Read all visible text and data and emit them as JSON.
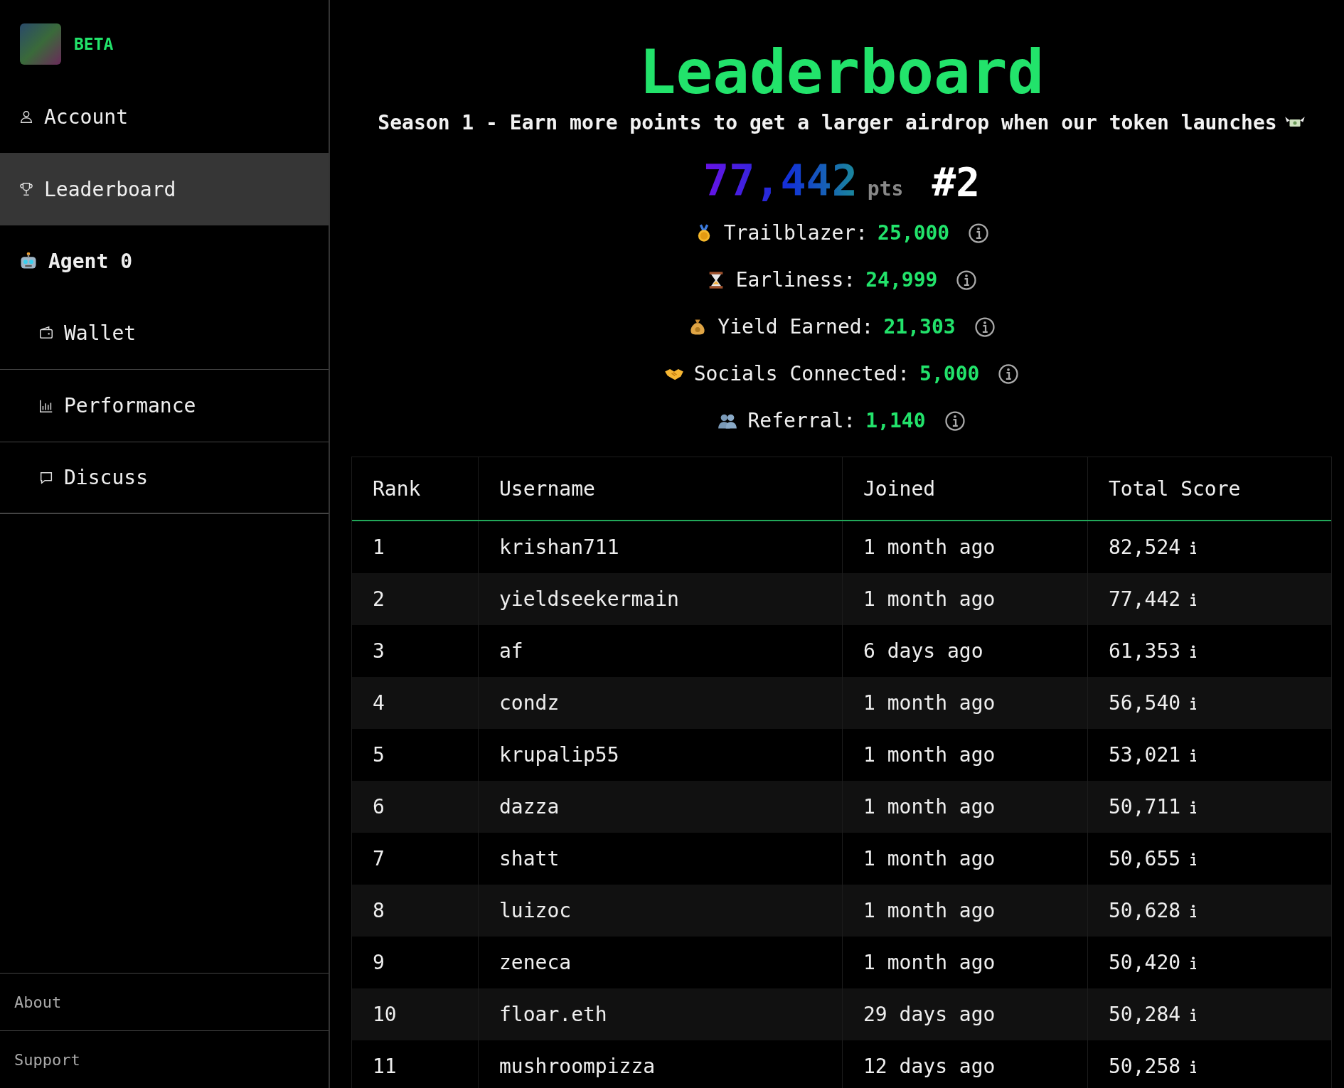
{
  "sidebar": {
    "brand": {
      "badge": "BETA"
    },
    "items": [
      {
        "kind": "link",
        "label": "Account",
        "selected": false
      },
      {
        "kind": "link",
        "label": "Leaderboard",
        "selected": true
      },
      {
        "kind": "section",
        "label": "Agent 0"
      },
      {
        "kind": "subitem",
        "label": "Wallet",
        "selected": false
      },
      {
        "kind": "subitem",
        "label": "Performance",
        "selected": false
      },
      {
        "kind": "subitem",
        "label": "Discuss",
        "selected": false
      }
    ],
    "footer": [
      "About",
      "Support"
    ]
  },
  "header": {
    "title": "Leaderboard",
    "subtitle": "Season 1 - Earn more points to get a larger airdrop when our token launches",
    "points": "77,442",
    "points_unit": "pts",
    "rank": "#2"
  },
  "breakdown": [
    {
      "label": "Trailblazer:",
      "value": "25,000"
    },
    {
      "label": "Earliness:",
      "value": "24,999"
    },
    {
      "label": "Yield Earned:",
      "value": "21,303"
    },
    {
      "label": "Socials Connected:",
      "value": "5,000"
    },
    {
      "label": "Referral:",
      "value": "1,140"
    }
  ],
  "table": {
    "columns": [
      "Rank",
      "Username",
      "Joined",
      "Total Score"
    ],
    "rows": [
      {
        "rank": "1",
        "username": "krishan711",
        "joined": "1 month ago",
        "score": "82,524"
      },
      {
        "rank": "2",
        "username": "yieldseekermain",
        "joined": "1 month ago",
        "score": "77,442"
      },
      {
        "rank": "3",
        "username": "af",
        "joined": "6 days ago",
        "score": "61,353"
      },
      {
        "rank": "4",
        "username": "condz",
        "joined": "1 month ago",
        "score": "56,540"
      },
      {
        "rank": "5",
        "username": "krupalip55",
        "joined": "1 month ago",
        "score": "53,021"
      },
      {
        "rank": "6",
        "username": "dazza",
        "joined": "1 month ago",
        "score": "50,711"
      },
      {
        "rank": "7",
        "username": "shatt",
        "joined": "1 month ago",
        "score": "50,655"
      },
      {
        "rank": "8",
        "username": "luizoc",
        "joined": "1 month ago",
        "score": "50,628"
      },
      {
        "rank": "9",
        "username": "zeneca",
        "joined": "1 month ago",
        "score": "50,420"
      },
      {
        "rank": "10",
        "username": "floar.eth",
        "joined": "29 days ago",
        "score": "50,284"
      },
      {
        "rank": "11",
        "username": "mushroompizza",
        "joined": "12 days ago",
        "score": "50,258"
      }
    ]
  }
}
